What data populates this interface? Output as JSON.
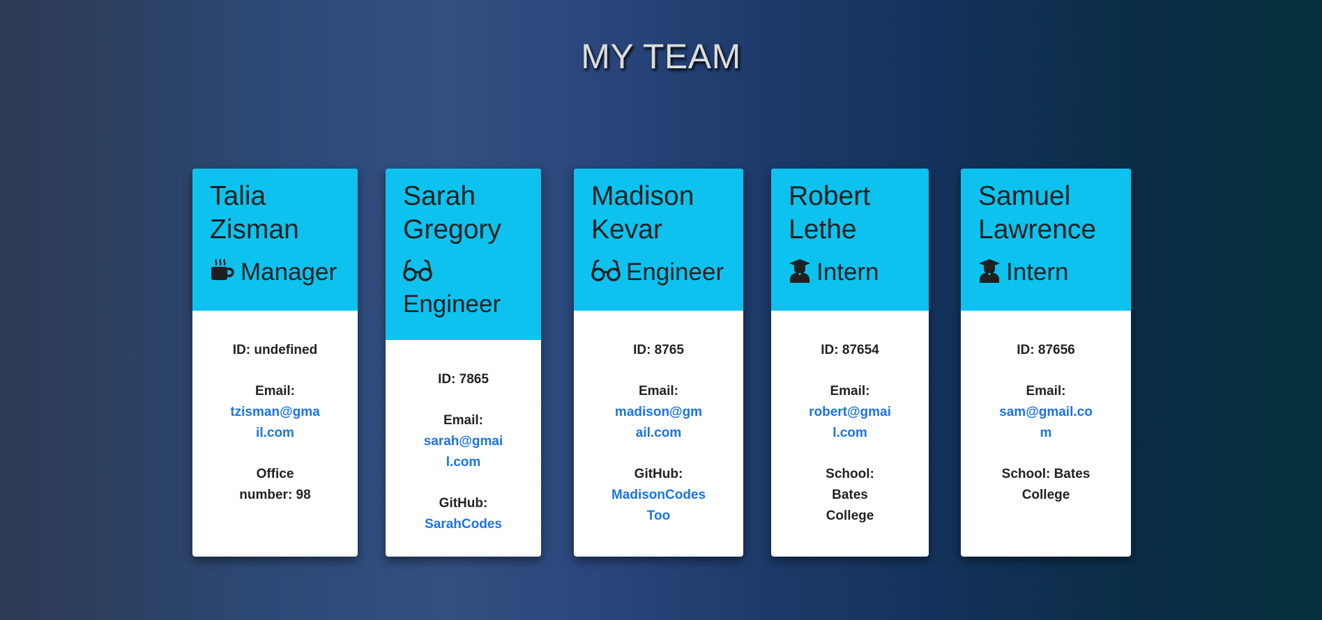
{
  "page": {
    "title": "MY TEAM"
  },
  "colors": {
    "header_accent": "#0dc2ee",
    "link": "#1a73e8"
  },
  "team": [
    {
      "name_first": "Talia",
      "name_last": "Zisman",
      "role": "Manager",
      "icon": "coffee-mug-icon",
      "id_text": "ID: undefined",
      "email_label": "Email:",
      "email_line1": "tzisman@gma",
      "email_line2": "il.com",
      "extra_line1": "Office",
      "extra_line2": "number: 98",
      "extra_line3": ""
    },
    {
      "name_first": "Sarah",
      "name_last": "Gregory",
      "role": "Engineer",
      "icon": "glasses-icon",
      "id_text": "ID: 7865",
      "email_label": "Email:",
      "email_line1": "sarah@gmai",
      "email_line2": "l.com",
      "github_label": "GitHub:",
      "github_line1": "SarahCodes",
      "github_line2": ""
    },
    {
      "name_first": "Madison",
      "name_last": "Kevar",
      "role": "Engineer",
      "icon": "glasses-icon",
      "id_text": "ID: 8765",
      "email_label": "Email:",
      "email_line1": "madison@gm",
      "email_line2": "ail.com",
      "github_label": "GitHub:",
      "github_line1": "MadisonCodes",
      "github_line2": "Too"
    },
    {
      "name_first": "Robert",
      "name_last": "Lethe",
      "role": "Intern",
      "icon": "graduate-icon",
      "id_text": "ID: 87654",
      "email_label": "Email:",
      "email_line1": "robert@gmai",
      "email_line2": "l.com",
      "extra_line1": "School:",
      "extra_line2": "Bates",
      "extra_line3": "College"
    },
    {
      "name_first": "Samuel",
      "name_last": "Lawrence",
      "role": "Intern",
      "icon": "graduate-icon",
      "id_text": "ID: 87656",
      "email_label": "Email:",
      "email_line1": "sam@gmail.co",
      "email_line2": "m",
      "extra_line1": "School: Bates",
      "extra_line2": "College",
      "extra_line3": ""
    }
  ]
}
